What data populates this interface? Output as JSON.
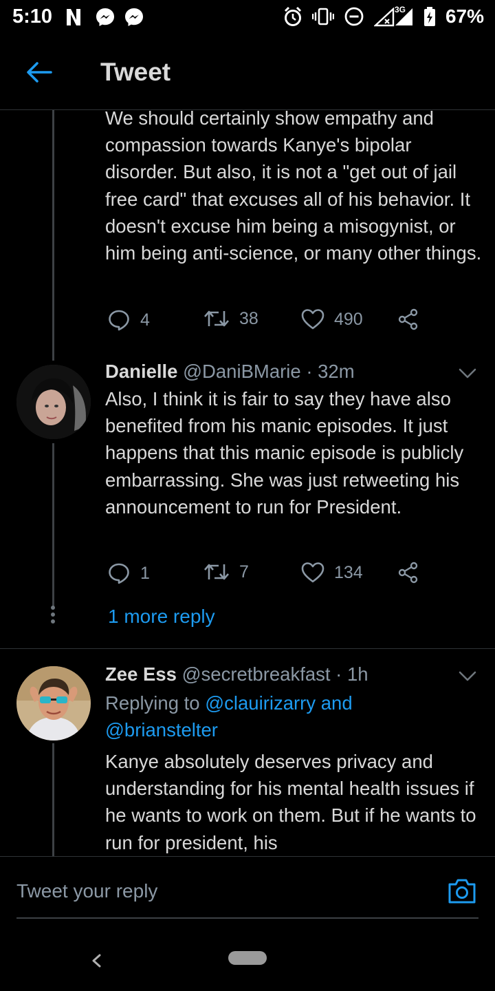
{
  "status_bar": {
    "time": "5:10",
    "battery": "67%",
    "network": "3G",
    "icons": [
      "netflix-icon",
      "messenger-icon",
      "messenger-icon",
      "alarm-icon",
      "vibrate-icon",
      "do-not-disturb-icon",
      "signal-icon",
      "battery-charging-icon"
    ]
  },
  "header": {
    "title": "Tweet"
  },
  "tweets": [
    {
      "text": "We should certainly show empathy and compassion towards Kanye's bipolar disorder. But also, it is not a \"get out of jail free card\" that excuses all of his behavior. It doesn't excuse him being a misogynist, or him being anti-science, or many other things.",
      "replies": "4",
      "retweets": "38",
      "likes": "490"
    },
    {
      "name": "Danielle",
      "handle": "@DaniBMarie · 32m",
      "text": "Also, I think it is fair to say they have also benefited from his manic episodes. It just happens that this manic episode is publicly embarrassing. She was just retweeting his announcement to run for President.",
      "replies": "1",
      "retweets": "7",
      "likes": "134",
      "more_replies": "1 more reply"
    },
    {
      "name": "Zee Ess",
      "handle": "@secretbreakfast · 1h",
      "replying_prefix": "Replying to ",
      "replying_to": "@clauirizarry and @brianstelter",
      "text": "Kanye absolutely deserves privacy and understanding for his mental health issues if he wants to work on them. But if he wants to run for president, his"
    }
  ],
  "reply_box": {
    "placeholder": "Tweet your reply"
  },
  "colors": {
    "accent": "#1d9bf0",
    "muted": "#8b98a5",
    "text": "#d9d9d9",
    "background": "#000000"
  }
}
